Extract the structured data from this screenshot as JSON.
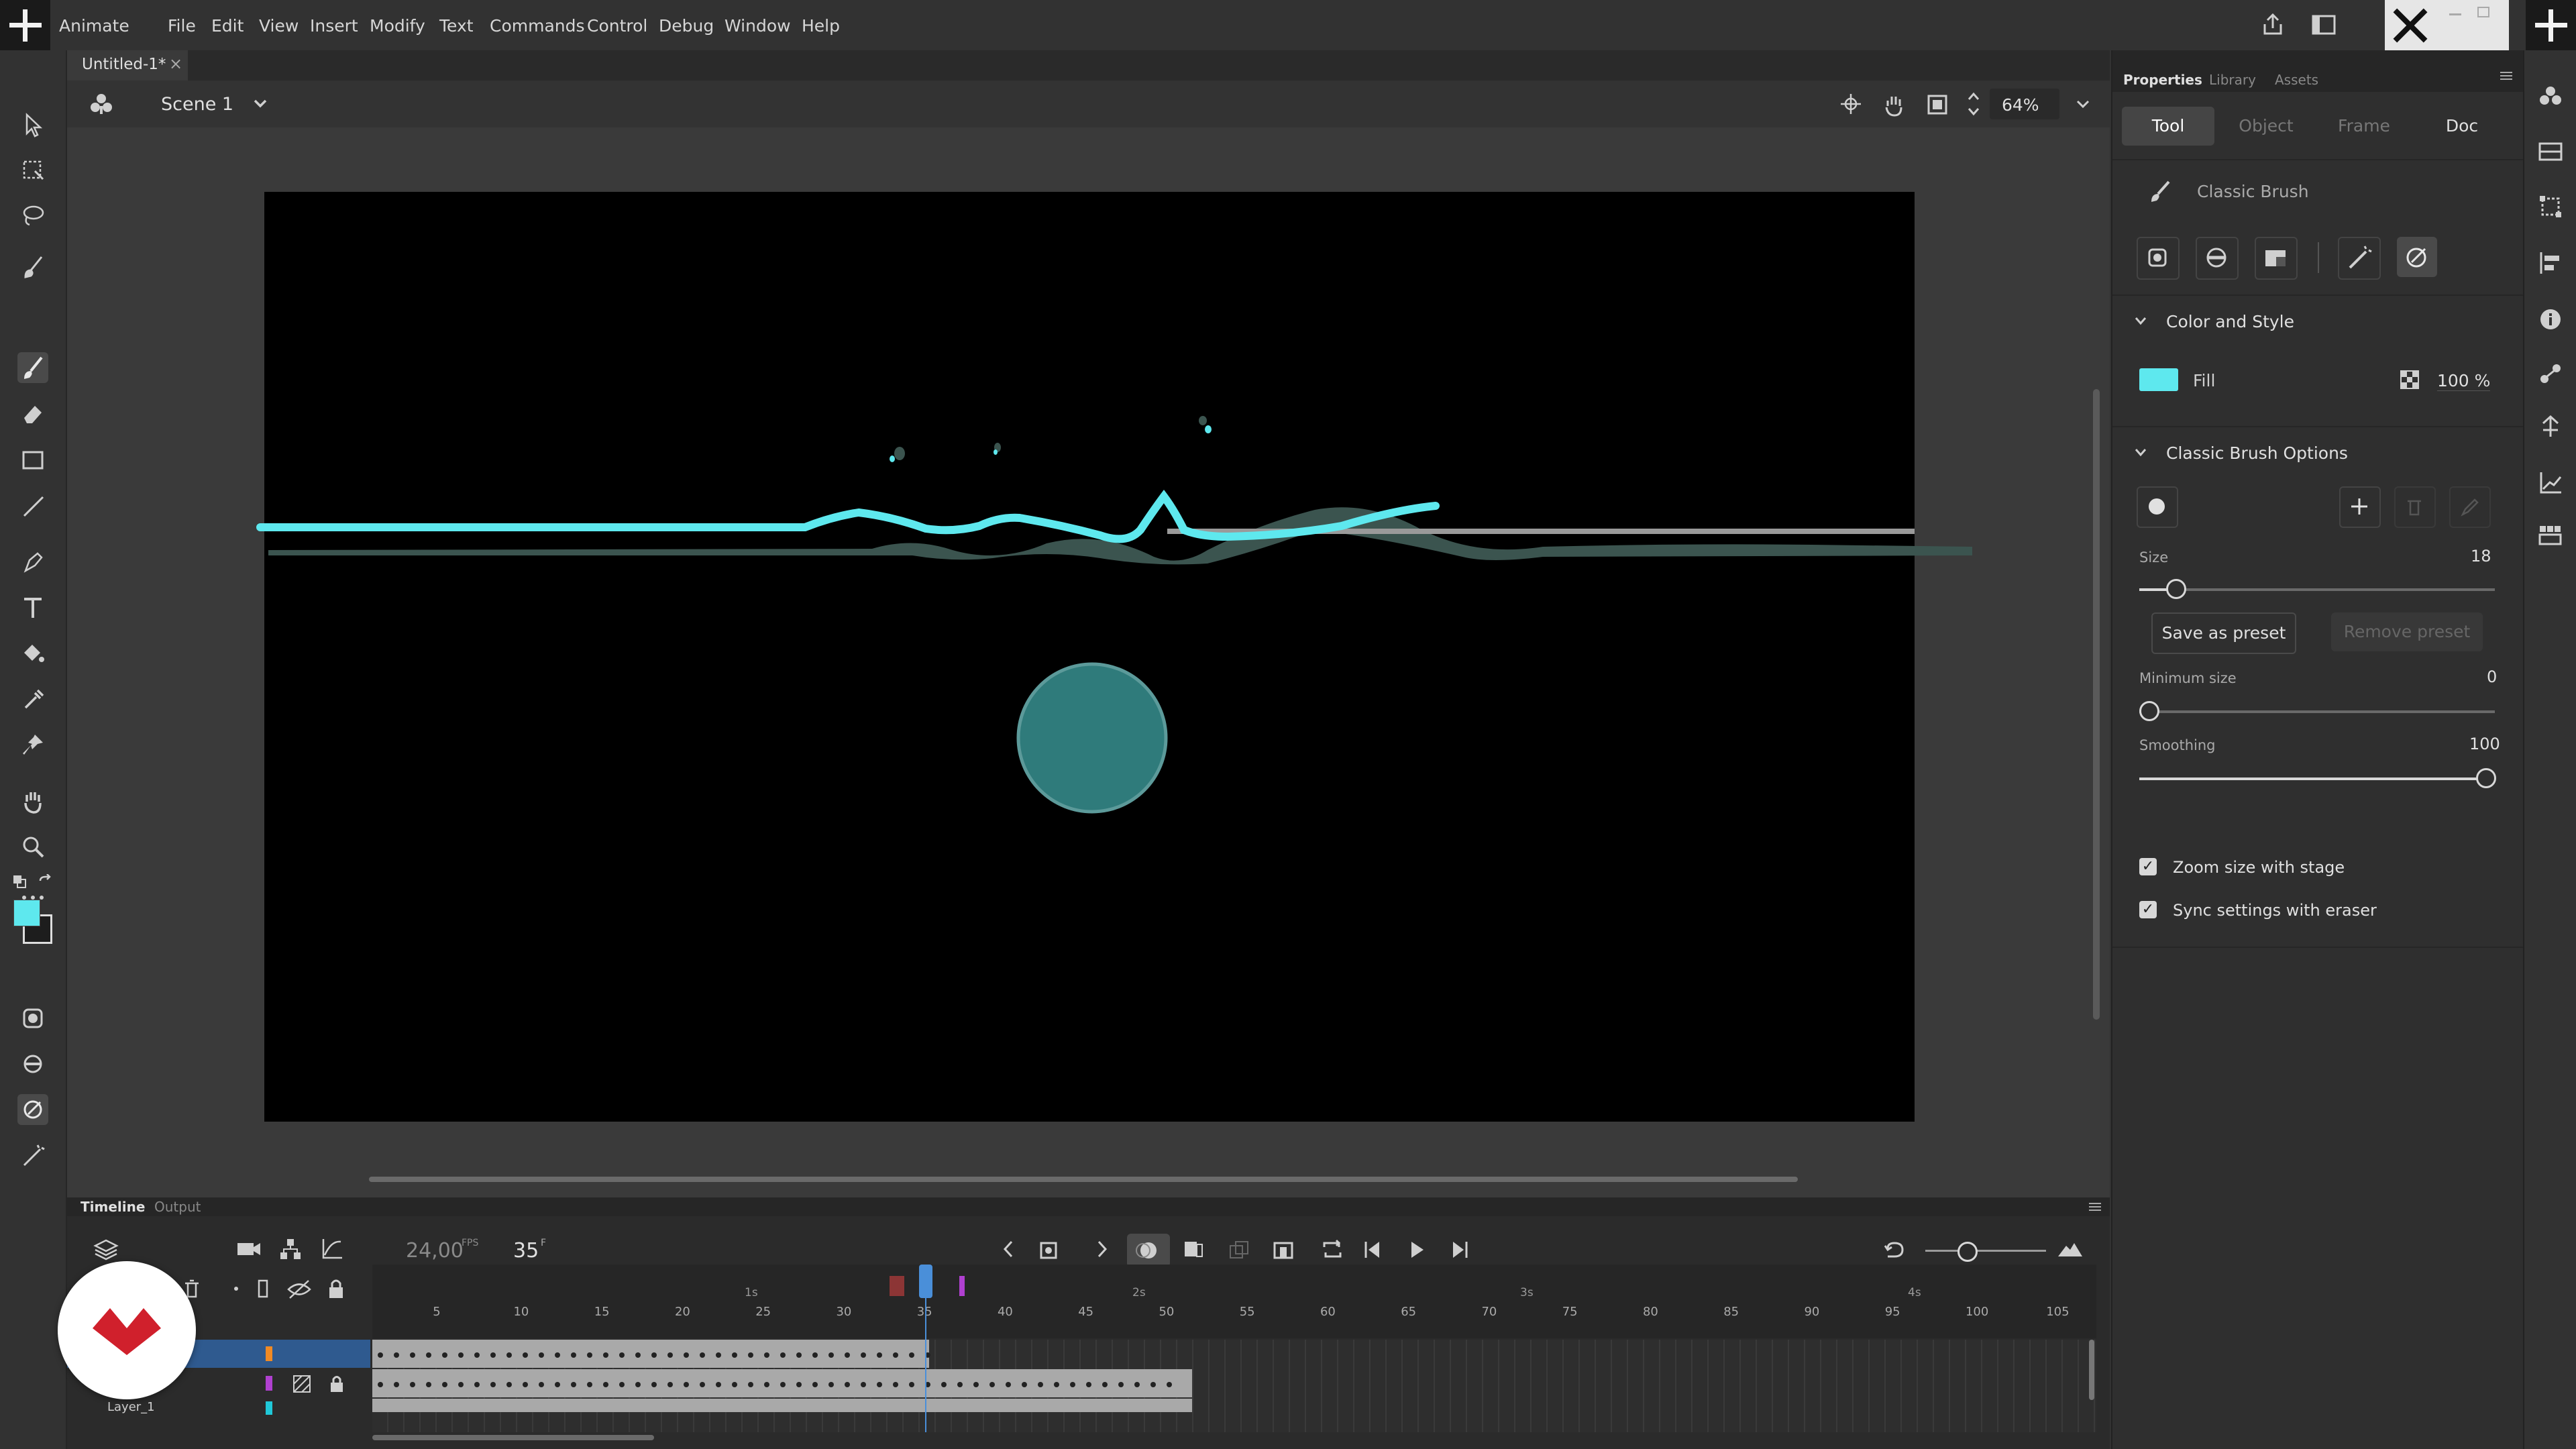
{
  "app": {
    "name": "Animate"
  },
  "menu": [
    "File",
    "Edit",
    "View",
    "Insert",
    "Modify",
    "Text",
    "Commands",
    "Control",
    "Debug",
    "Window",
    "Help"
  ],
  "document_tab": {
    "title": "Untitled-1*",
    "close": "×"
  },
  "scene": {
    "name": "Scene 1",
    "zoom": "64%"
  },
  "properties": {
    "tabs": [
      "Properties",
      "Library",
      "Assets"
    ],
    "subtabs": [
      "Tool",
      "Object",
      "Frame",
      "Doc"
    ],
    "tool_name": "Classic Brush",
    "color_style": {
      "title": "Color and Style",
      "fill_label": "Fill",
      "fill_color": "#5ee8ee",
      "alpha": "100 %"
    },
    "brush_options": {
      "title": "Classic Brush Options",
      "size_label": "Size",
      "size_value": "18",
      "save_preset": "Save as preset",
      "remove_preset": "Remove preset",
      "min_size_label": "Minimum size",
      "min_size_value": "0",
      "smoothing_label": "Smoothing",
      "smoothing_value": "100",
      "zoom_label": "Zoom size with stage",
      "sync_label": "Sync settings with eraser"
    }
  },
  "timeline": {
    "tabs": [
      "Timeline",
      "Output"
    ],
    "fps": "24,00",
    "fps_unit": "FPS",
    "frame": "35",
    "frame_unit": "F",
    "seconds": [
      "1s",
      "2s",
      "3s",
      "4s"
    ],
    "frame_numbers": [
      "5",
      "10",
      "15",
      "20",
      "25",
      "30",
      "35",
      "40",
      "45",
      "50",
      "55",
      "60",
      "65",
      "70",
      "75",
      "80",
      "85",
      "90",
      "95",
      "100",
      "105"
    ],
    "layer_name": "Layer_1"
  },
  "colors": {
    "accent": "#5ee8ee",
    "stage": "#000000",
    "playhead": "#4a8fd9",
    "selection": "#2f5a8f",
    "ball": "#2f7b7b",
    "grey_stroke": "#3b544f"
  }
}
